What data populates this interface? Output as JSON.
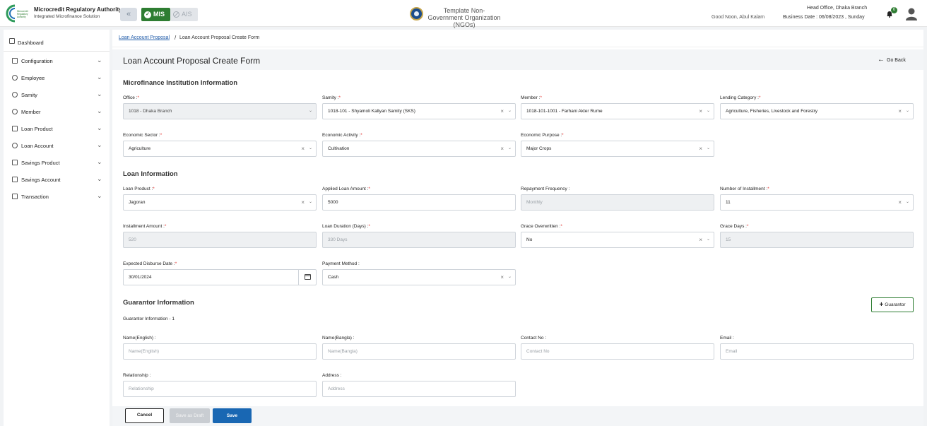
{
  "app": {
    "title": "Microcredit Regulatory Authority",
    "subtitle": "Integrated Microfinance Solution",
    "logo_text": "Microcredit Regulatory Authority",
    "modules": {
      "mis": "MIS",
      "ais": "AIS"
    },
    "organization": "Template Non-Government Organization (NGOs)",
    "greeting": "Good Noon, Abul Kalam",
    "office": "Head Office, Dhaka Branch",
    "business_date": "Business Date : 06/08/2023 , Sunday",
    "notification_count": "0",
    "icons": [
      "double-chevron-left-icon",
      "check-circle-icon",
      "ban-icon",
      "bell-icon",
      "user-icon"
    ],
    "colors": {
      "brand_green": "#2e7d32",
      "primary_blue": "#1967b3",
      "required_red": "#e53935"
    }
  },
  "sidebar": {
    "dashboard": "Dashboard",
    "items": [
      {
        "label": "Configuration",
        "icon": "sliders-icon"
      },
      {
        "label": "Employee",
        "icon": "employee-icon"
      },
      {
        "label": "Samity",
        "icon": "group-icon"
      },
      {
        "label": "Member",
        "icon": "member-icon"
      },
      {
        "label": "Loan Product",
        "icon": "document-icon"
      },
      {
        "label": "Loan Account",
        "icon": "account-icon"
      },
      {
        "label": "Savings Product",
        "icon": "document-icon"
      },
      {
        "label": "Savings Account",
        "icon": "document-icon"
      },
      {
        "label": "Transaction",
        "icon": "document-icon"
      }
    ]
  },
  "breadcrumb": {
    "link": "Loan Account Proposal",
    "separator": "/",
    "current": "Loan Account Proposal Create Form"
  },
  "page": {
    "title": "Loan Account Proposal Create Form",
    "go_back": "Go Back"
  },
  "sections": {
    "mfi": "Microfinance Institution Information",
    "loan": "Loan Information",
    "guarantor": "Guarantor Information"
  },
  "form": {
    "office": {
      "label": "Office :",
      "value": "1018 - Dhaka Branch"
    },
    "samity": {
      "label": "Samity :",
      "value": "1018-101 - Shyamoli Kallyan Samity (SKS)"
    },
    "member": {
      "label": "Member :",
      "value": "1018-101-1001 - Farhani Akter Rume"
    },
    "lending_category": {
      "label": "Lending Category :",
      "value": "Agriculture, Fisheries, Livestock and Forestry"
    },
    "economic_sector": {
      "label": "Economic Sector :",
      "value": "Agriculture"
    },
    "economic_activity": {
      "label": "Economic Activity :",
      "value": "Cultivation"
    },
    "economic_purpose": {
      "label": "Economic Purpose :",
      "value": "Major Crops"
    },
    "loan_product": {
      "label": "Loan Product :",
      "value": "Jagoran"
    },
    "applied_amount": {
      "label": "Applied Loan Amount :",
      "value": "5000"
    },
    "repayment_frequency": {
      "label": "Repayment Frequency :",
      "value": "Monthly"
    },
    "num_installment": {
      "label": "Number of Installment :",
      "value": "11"
    },
    "installment_amount": {
      "label": "Installment Amount :",
      "value": "520"
    },
    "loan_duration": {
      "label": "Loan Duration (Days) :",
      "value": "330 Days"
    },
    "grace_overwritten": {
      "label": "Grace Overwritten :",
      "value": "No"
    },
    "grace_days": {
      "label": "Grace Days :",
      "value": "15"
    },
    "disburse_date": {
      "label": "Expected Disburse Date :",
      "value": "30/01/2024"
    },
    "payment_method": {
      "label": "Payment Method :",
      "value": "Cash"
    }
  },
  "guarantor": {
    "add_button": "Guarantor",
    "subheading": "Guarantor Information - 1",
    "name_en": {
      "label": "Name(English) :",
      "placeholder": "Name(English)"
    },
    "name_bn": {
      "label": "Name(Bangla) :",
      "placeholder": "Name(Bangla)"
    },
    "contact": {
      "label": "Contact No :",
      "placeholder": "Contact No"
    },
    "email": {
      "label": "Email :",
      "placeholder": "Email"
    },
    "relationship": {
      "label": "Relationship :",
      "placeholder": "Relationship"
    },
    "address": {
      "label": "Address :",
      "placeholder": "Address"
    }
  },
  "actions": {
    "cancel": "Cancel",
    "save_draft": "Save as Draft",
    "save": "Save"
  },
  "symbols": {
    "required": "*",
    "clear": "×",
    "dropdown": "⌄",
    "chevron": "⌄",
    "back_arrow": "←",
    "plus": "+"
  }
}
